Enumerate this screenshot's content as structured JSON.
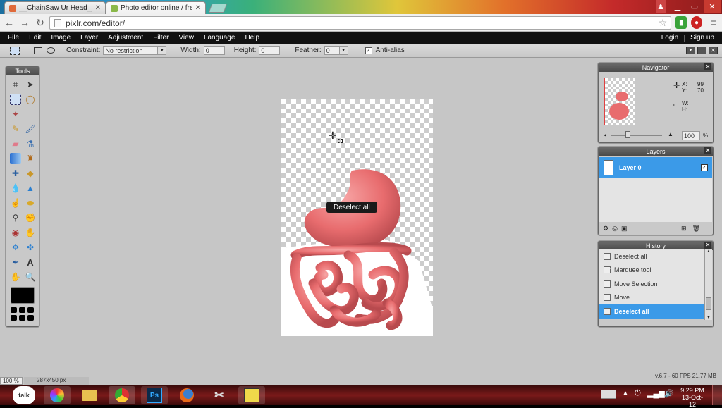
{
  "browser": {
    "tabs": [
      {
        "title": "__ChainSaw Ur Head__ Pho",
        "close": "✕"
      },
      {
        "title": "Photo editor online / free",
        "close": "✕"
      }
    ],
    "url": "pixlr.com/editor/"
  },
  "menu": [
    "File",
    "Edit",
    "Image",
    "Layer",
    "Adjustment",
    "Filter",
    "View",
    "Language",
    "Help"
  ],
  "account": {
    "login": "Login",
    "signup": "Sign up"
  },
  "toolbar": {
    "constraint_label": "Constraint:",
    "constraint_value": "No restriction",
    "width_label": "Width:",
    "width_value": "0",
    "height_label": "Height:",
    "height_value": "0",
    "feather_label": "Feather:",
    "feather_value": "0",
    "antialias_label": "Anti-alias",
    "antialias_checked": true
  },
  "tools_panel": {
    "title": "Tools"
  },
  "navigator": {
    "title": "Navigator",
    "x_label": "X:",
    "x_value": "99",
    "y_label": "Y:",
    "y_value": "70",
    "w_label": "W:",
    "h_label": "H:",
    "zoom": "100",
    "zoom_unit": "%"
  },
  "layers": {
    "title": "Layers",
    "items": [
      {
        "name": "Layer 0",
        "checked": true
      }
    ]
  },
  "history": {
    "title": "History",
    "items": [
      "Deselect all",
      "Marquee tool",
      "Move Selection",
      "Move",
      "Deselect all"
    ],
    "selected_index": 4
  },
  "canvas": {
    "tooltip": "Deselect all"
  },
  "status": {
    "zoom": "100 %",
    "size": "287x450 px",
    "version": "v.6.7 - 60 FPS 21.77 MB"
  },
  "taskbar": {
    "apps": [
      "talk",
      "",
      "",
      "",
      "Ps",
      "",
      "",
      ""
    ],
    "time": "9:29 PM",
    "date": "13-Oct-12"
  },
  "colors": {
    "menubar": "#111111",
    "workspace": "#c6c6c6",
    "selection_blue": "#3b9ae8",
    "organ_pink": "#e86c6e"
  }
}
